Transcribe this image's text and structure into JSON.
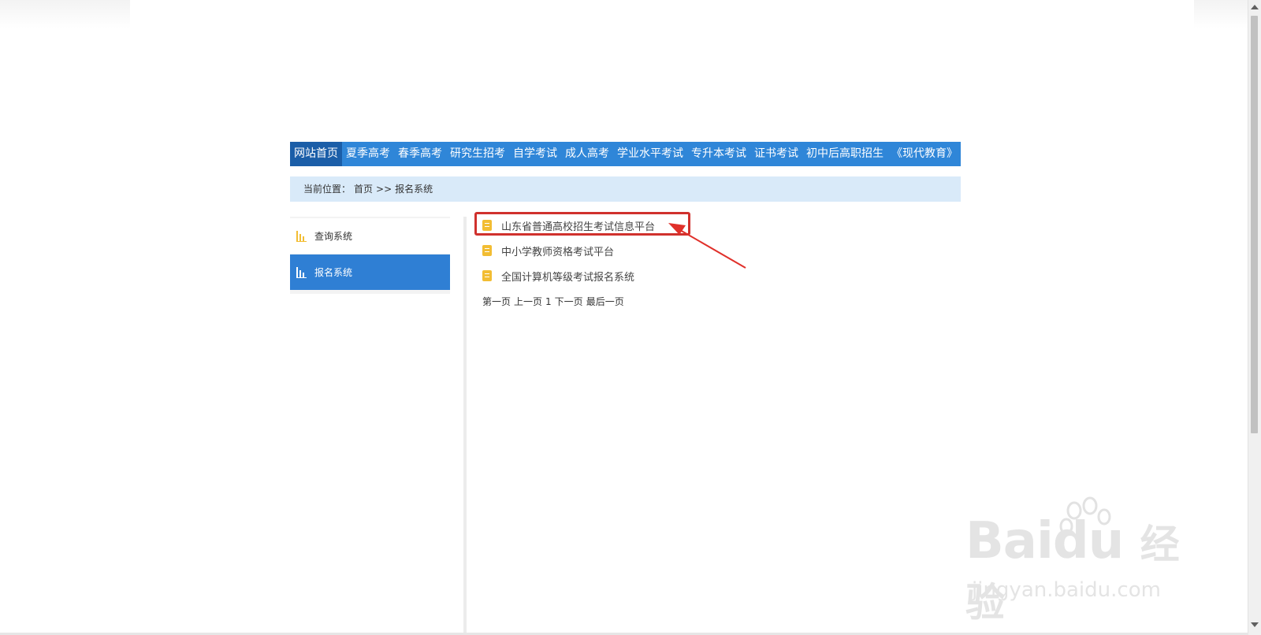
{
  "nav": {
    "items": [
      {
        "label": "网站首页",
        "active": true
      },
      {
        "label": "夏季高考"
      },
      {
        "label": "春季高考"
      },
      {
        "label": "研究生招考"
      },
      {
        "label": "自学考试"
      },
      {
        "label": "成人高考"
      },
      {
        "label": "学业水平考试"
      },
      {
        "label": "专升本考试"
      },
      {
        "label": "证书考试"
      },
      {
        "label": "初中后高职招生"
      },
      {
        "label": "《现代教育》"
      }
    ]
  },
  "breadcrumb": {
    "prefix": "当前位置：",
    "home": "首页",
    "separator": ">>",
    "current": "报名系统"
  },
  "sidebar": {
    "items": [
      {
        "label": "查询系统",
        "icon": "bar-chart-icon",
        "active": false
      },
      {
        "label": "报名系统",
        "icon": "bar-chart-icon",
        "active": true
      }
    ]
  },
  "list": {
    "items": [
      {
        "label": "山东省普通高校招生考试信息平台",
        "icon": "document-icon",
        "highlighted": true
      },
      {
        "label": "中小学教师资格考试平台",
        "icon": "document-icon"
      },
      {
        "label": "全国计算机等级考试报名系统",
        "icon": "document-icon"
      }
    ]
  },
  "pager": {
    "first": "第一页",
    "prev": "上一页",
    "current": "1",
    "next": "下一页",
    "last": "最后一页"
  },
  "watermark": {
    "logo_left": "Bai",
    "logo_right": "du",
    "logo_cn": "经验",
    "sub": "jingyan.baidu.com"
  },
  "colors": {
    "nav_bg": "#2f86d8",
    "nav_active": "#1b5ea8",
    "breadcrumb_bg": "#d9eaf9",
    "sidebar_active": "#2f7fd4",
    "doc_icon": "#f2bd33",
    "highlight_red": "#d0312d"
  }
}
